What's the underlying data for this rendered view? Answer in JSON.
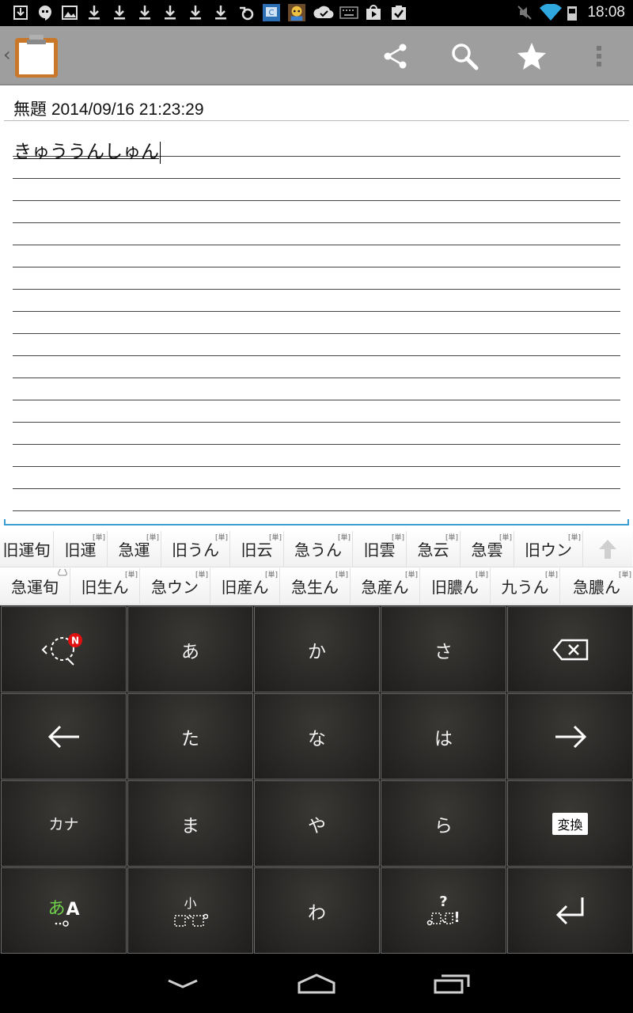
{
  "status_bar": {
    "time": "18:08",
    "icons": [
      "download-icon",
      "hangouts-icon",
      "image-icon",
      "download-icon",
      "download-icon",
      "download-icon",
      "download-icon",
      "download-icon",
      "download-icon",
      "sync-icon",
      "app-c-icon",
      "game-icon",
      "check-cloud-icon",
      "keyboard-icon",
      "play-store-icon",
      "task-icon",
      "mute-icon",
      "wifi-icon",
      "battery-icon"
    ]
  },
  "action_bar": {
    "icons": [
      "share-icon",
      "search-icon",
      "star-icon",
      "overflow-menu-icon"
    ]
  },
  "note": {
    "title": "無題 2014/09/16 21:23:29",
    "body": "きゅううんしゅん"
  },
  "candidates": {
    "row1": [
      {
        "text": "旧運旬",
        "tag": ""
      },
      {
        "text": "旧運",
        "tag": "[単]"
      },
      {
        "text": "急運",
        "tag": "[単]"
      },
      {
        "text": "旧うん",
        "tag": "[単]"
      },
      {
        "text": "旧云",
        "tag": "[単]"
      },
      {
        "text": "急うん",
        "tag": "[単]"
      },
      {
        "text": "旧雲",
        "tag": "[単]"
      },
      {
        "text": "急云",
        "tag": "[単]"
      },
      {
        "text": "急雲",
        "tag": "[単]"
      },
      {
        "text": "旧ウン",
        "tag": "[単]"
      }
    ],
    "row2": [
      {
        "text": "急運旬",
        "tag": ""
      },
      {
        "text": "旧生ん",
        "tag": "[単]"
      },
      {
        "text": "急ウン",
        "tag": "[単]"
      },
      {
        "text": "旧産ん",
        "tag": "[単]"
      },
      {
        "text": "急生ん",
        "tag": "[単]"
      },
      {
        "text": "急産ん",
        "tag": "[単]"
      },
      {
        "text": "旧膿ん",
        "tag": "[単]"
      },
      {
        "text": "九うん",
        "tag": "[単]"
      },
      {
        "text": "急膿ん",
        "tag": "[単]"
      }
    ]
  },
  "keyboard": {
    "a": "あ",
    "ka": "か",
    "sa": "さ",
    "ta": "た",
    "na": "な",
    "ha": "は",
    "kana": "カナ",
    "ma": "ま",
    "ya": "や",
    "ra": "ら",
    "henkan": "変換",
    "mode_kana": "あ",
    "mode_alpha": "A",
    "small_label": "小",
    "wa": "わ",
    "question": "?",
    "exclaim": "!",
    "badge": "N"
  },
  "colors": {
    "accent": "#3a9fd0",
    "action_bar": "#9e9e9e",
    "keyboard_bg": "#2a2826",
    "badge": "#e01010",
    "mode_green": "#6fd14a"
  }
}
